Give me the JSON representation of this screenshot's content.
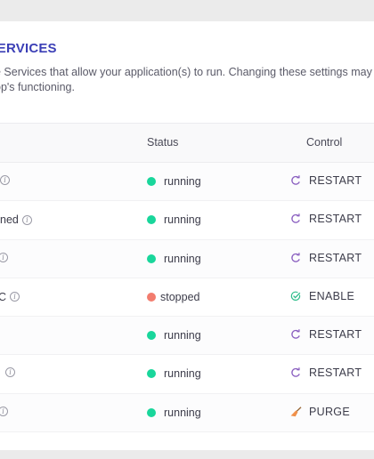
{
  "section": {
    "title": "E SERVICES",
    "description_line1": "e Services that allow your application(s) to run. Changing these settings may",
    "description_line2": "op's functioning."
  },
  "table": {
    "headers": {
      "status": "Status",
      "control": "Control"
    },
    "rows": [
      {
        "name": "",
        "name_offset": "-6",
        "status": "running",
        "status_color": "#19d69b",
        "control": "RESTART",
        "control_icon": "restart-icon"
      },
      {
        "name": "ned",
        "status": "running",
        "status_color": "#19d69b",
        "control": "RESTART",
        "control_icon": "restart-icon"
      },
      {
        "name": "",
        "status": "running",
        "status_color": "#19d69b",
        "control": "RESTART",
        "control_icon": "restart-icon"
      },
      {
        "name": "C",
        "status": "stopped",
        "status_color": "#f27c6e",
        "control": "ENABLE",
        "control_icon": "enable-check-icon"
      },
      {
        "name": "",
        "status": "running",
        "status_color": "#19d69b",
        "control": "RESTART",
        "control_icon": "restart-icon"
      },
      {
        "name": "",
        "status": "running",
        "status_color": "#19d69b",
        "control": "RESTART",
        "control_icon": "restart-icon"
      },
      {
        "name": "",
        "status": "running",
        "status_color": "#19d69b",
        "control": "PURGE",
        "control_icon": "broom-icon"
      }
    ]
  },
  "colors": {
    "accent": "#3b3fb6",
    "running": "#19d69b",
    "stopped": "#f27c6e",
    "restart_icon": "#8a5fc0",
    "enable_icon": "#2dbd8a",
    "purge_icon": "#f0904a"
  }
}
